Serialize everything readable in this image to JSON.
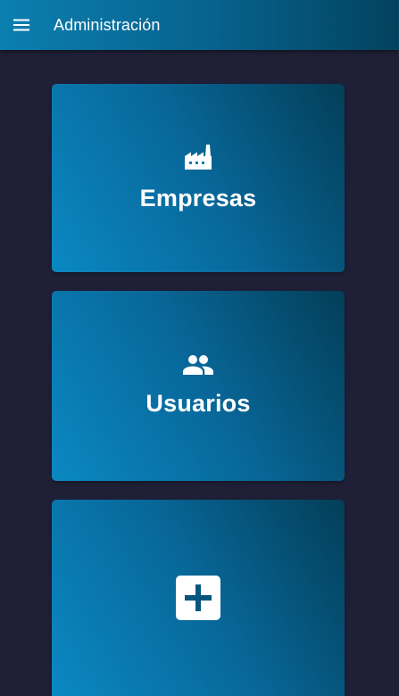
{
  "appbar": {
    "title": "Administración",
    "menu_icon": "menu-icon"
  },
  "cards": [
    {
      "label": "Empresas",
      "icon": "factory-icon"
    },
    {
      "label": "Usuarios",
      "icon": "people-icon"
    },
    {
      "label": "",
      "icon": "add-box-icon"
    }
  ],
  "colors": {
    "background": "#1f2037",
    "appbar": "#07618c",
    "card_light": "#0a88c2",
    "card_dark": "#033e58",
    "text": "#ffffff"
  }
}
